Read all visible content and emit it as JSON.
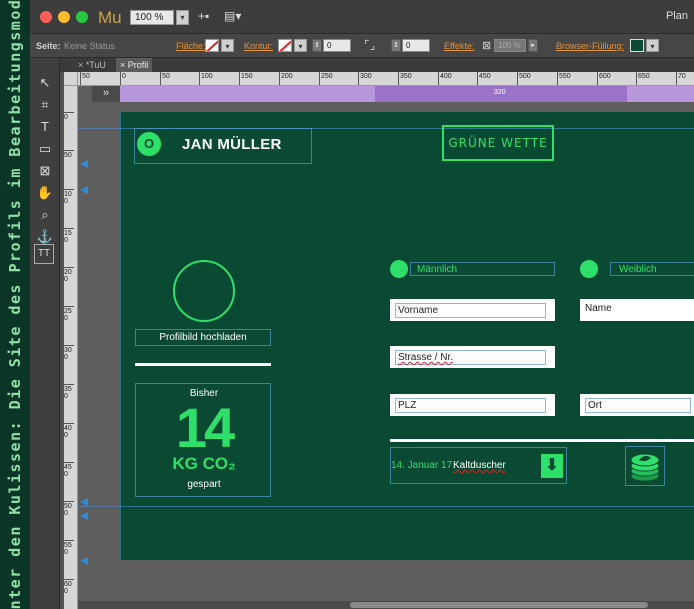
{
  "side_caption": "Hinter den Kulissen: Die Site des Profils im Bearbeitungsmodus",
  "window": {
    "app_name": "Mu",
    "zoom": "100 %",
    "title_partial": "Plan",
    "traffic_lights": [
      "#ff5f57",
      "#febc2e",
      "#28c840"
    ]
  },
  "controlbar": {
    "seite_label": "Seite:",
    "seite_value": "Keine Status",
    "flaeche_label": "Fläche:",
    "kontur_label": "Kontur:",
    "kontur_value": "0",
    "dim_value": "0",
    "effekte_label": "Effekte:",
    "effekte_value": "100 %",
    "browser_fill_label": "Browser-Füllung:"
  },
  "tabs": [
    {
      "label": "*TuU",
      "active": false
    },
    {
      "label": "Profil",
      "active": true
    }
  ],
  "ruler": {
    "h_ticks": [
      "50",
      "0",
      "50",
      "100",
      "150",
      "200",
      "250",
      "300",
      "350",
      "400",
      "450",
      "500",
      "550",
      "600",
      "650",
      "70"
    ],
    "v_ticks": [
      "0",
      "50",
      "100",
      "150",
      "200",
      "250",
      "300",
      "350",
      "400",
      "450",
      "500",
      "550",
      "600"
    ]
  },
  "breakpoint": {
    "control": "»",
    "label": "320",
    "color": "#b897dd"
  },
  "page": {
    "background": "#0b4a32",
    "accent": "#2ee06a",
    "logo_letter": "O",
    "user_name": "JAN MÜLLER",
    "wette_label": "GRÜNE WETTE",
    "upload_label": "Profilbild hochladen",
    "bisher": {
      "label": "Bisher",
      "value": "14",
      "unit": "KG CO₂",
      "caption": "gespart"
    },
    "gender": [
      {
        "label": "Männlich"
      },
      {
        "label": "Weiblich"
      }
    ],
    "fields": {
      "vorname": "Vorname",
      "name": "Name",
      "strasse": "Strasse / Nr.",
      "plz": "PLZ",
      "ort": "Ort"
    },
    "entry": {
      "date": "14. Januar 17",
      "text": "Kaltduscher",
      "arrow_icon": "arrow-down-icon"
    },
    "coins_icon": "coin-stack-icon"
  },
  "tools": [
    {
      "icon": "selection-arrow-icon",
      "glyph": "↖"
    },
    {
      "icon": "crop-icon",
      "glyph": "⌗"
    },
    {
      "icon": "text-icon",
      "glyph": "T"
    },
    {
      "icon": "rectangle-icon",
      "glyph": "▭"
    },
    {
      "icon": "image-frame-icon",
      "glyph": "⊠"
    },
    {
      "icon": "hand-icon",
      "glyph": "✋"
    },
    {
      "icon": "zoom-icon",
      "glyph": "⌕"
    },
    {
      "icon": "anchor-icon",
      "glyph": "⚓"
    },
    {
      "icon": "widget-icon",
      "glyph": "TT"
    }
  ]
}
